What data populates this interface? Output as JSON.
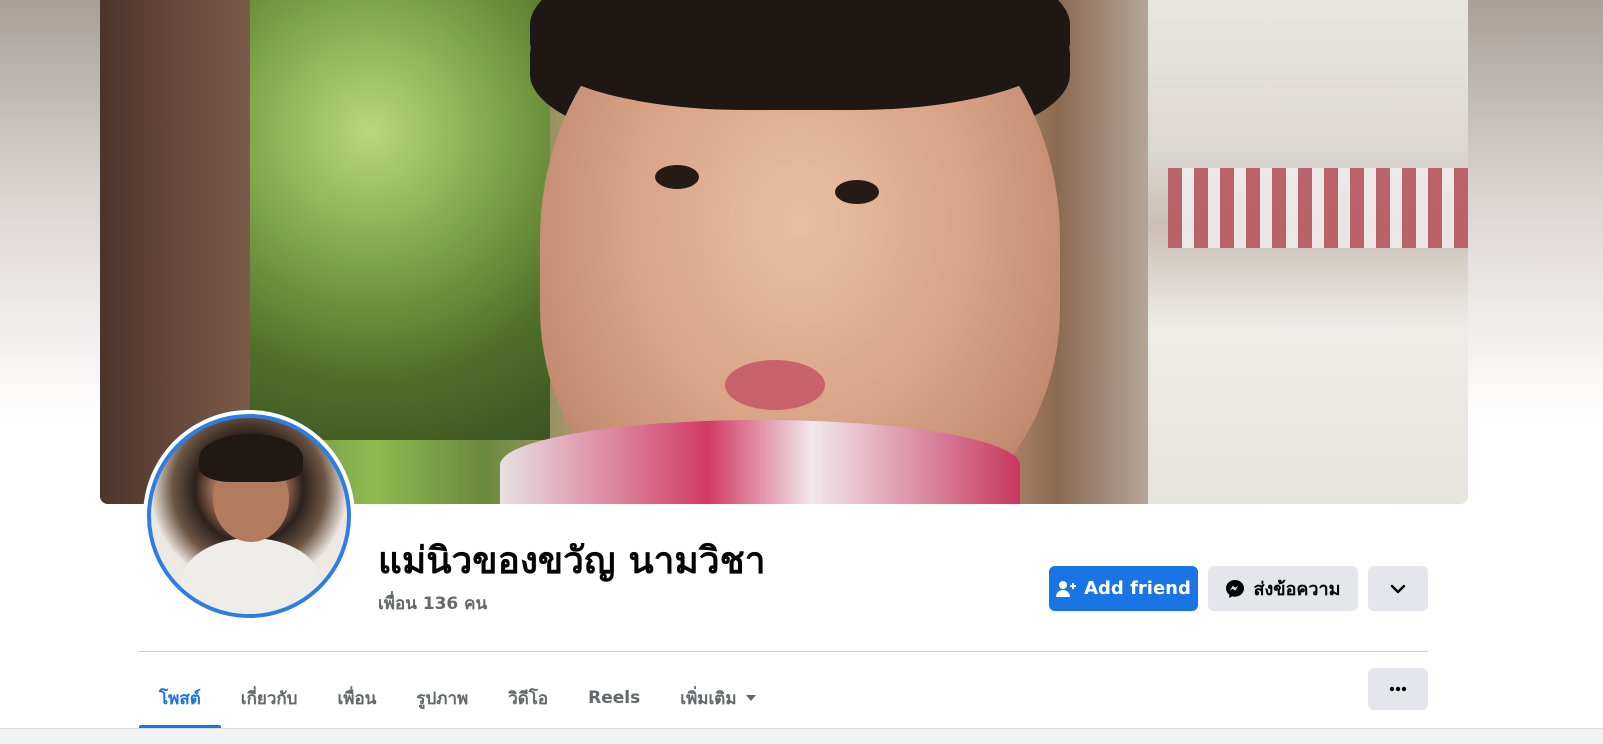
{
  "profile": {
    "name": "แม่นิวของขวัญ นามวิชา",
    "friends_count": "เพื่อน 136 คน"
  },
  "actions": {
    "add_friend": "Add friend",
    "message": "ส่งข้อความ",
    "more_icon": "chevron-down-icon"
  },
  "tabs": [
    {
      "label": "โพสต์",
      "active": true
    },
    {
      "label": "เกี่ยวกับ",
      "active": false
    },
    {
      "label": "เพื่อน",
      "active": false
    },
    {
      "label": "รูปภาพ",
      "active": false
    },
    {
      "label": "วิดีโอ",
      "active": false
    },
    {
      "label": "Reels",
      "active": false
    },
    {
      "label": "เพิ่มเติม",
      "active": false
    }
  ],
  "overflow_icon": "ellipsis-icon",
  "colors": {
    "accent": "#1b74e4",
    "secondary_button": "#e4e6eb",
    "text_primary": "#050505",
    "text_secondary": "#65676b"
  }
}
